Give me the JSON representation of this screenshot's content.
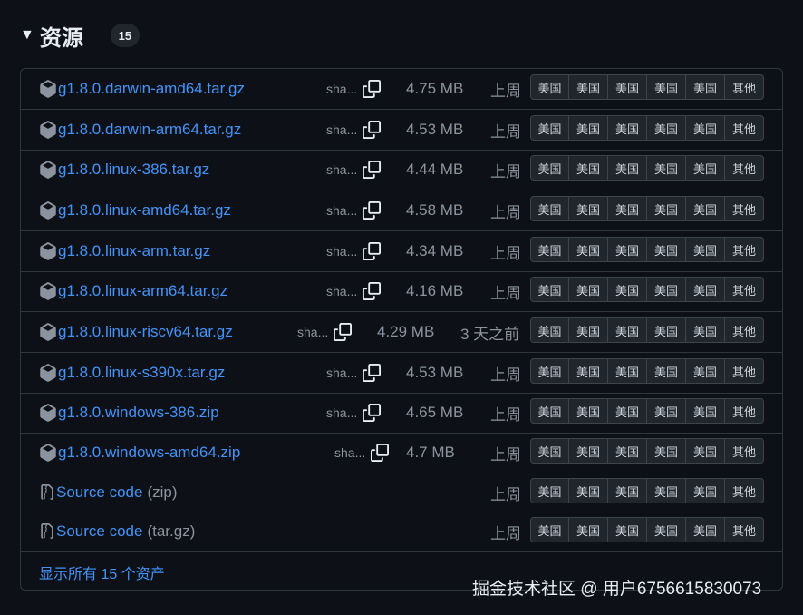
{
  "header": {
    "title": "资源",
    "count": "15"
  },
  "assets": [
    {
      "name": "g1.8.0.darwin-amd64.tar.gz",
      "sha": "sha...",
      "size": "4.75 MB",
      "date": "上周"
    },
    {
      "name": "g1.8.0.darwin-arm64.tar.gz",
      "sha": "sha...",
      "size": "4.53 MB",
      "date": "上周"
    },
    {
      "name": "g1.8.0.linux-386.tar.gz",
      "sha": "sha...",
      "size": "4.44 MB",
      "date": "上周"
    },
    {
      "name": "g1.8.0.linux-amd64.tar.gz",
      "sha": "sha...",
      "size": "4.58 MB",
      "date": "上周"
    },
    {
      "name": "g1.8.0.linux-arm.tar.gz",
      "sha": "sha...",
      "size": "4.34 MB",
      "date": "上周"
    },
    {
      "name": "g1.8.0.linux-arm64.tar.gz",
      "sha": "sha...",
      "size": "4.16 MB",
      "date": "上周"
    },
    {
      "name": "g1.8.0.linux-riscv64.tar.gz",
      "sha": "sha...",
      "size": "4.29 MB",
      "date": "3 天之前"
    },
    {
      "name": "g1.8.0.linux-s390x.tar.gz",
      "sha": "sha...",
      "size": "4.53 MB",
      "date": "上周"
    },
    {
      "name": "g1.8.0.windows-386.zip",
      "sha": "sha...",
      "size": "4.65 MB",
      "date": "上周"
    },
    {
      "name": "g1.8.0.windows-amd64.zip",
      "sha": "sha...",
      "size": "4.7 MB",
      "date": "上周"
    }
  ],
  "source": [
    {
      "name": "Source code",
      "format": "(zip)",
      "date": "上周"
    },
    {
      "name": "Source code",
      "format": "(tar.gz)",
      "date": "上周"
    }
  ],
  "mirror_labels": [
    "美国",
    "美国",
    "美国",
    "美国",
    "美国",
    "其他"
  ],
  "show_all": "显示所有 15 个资产",
  "watermark": "掘金技术社区 @ 用户6756615830073",
  "icons": {
    "asset": "package-icon",
    "source": "file-zip-icon",
    "sha": "copy-icon"
  }
}
